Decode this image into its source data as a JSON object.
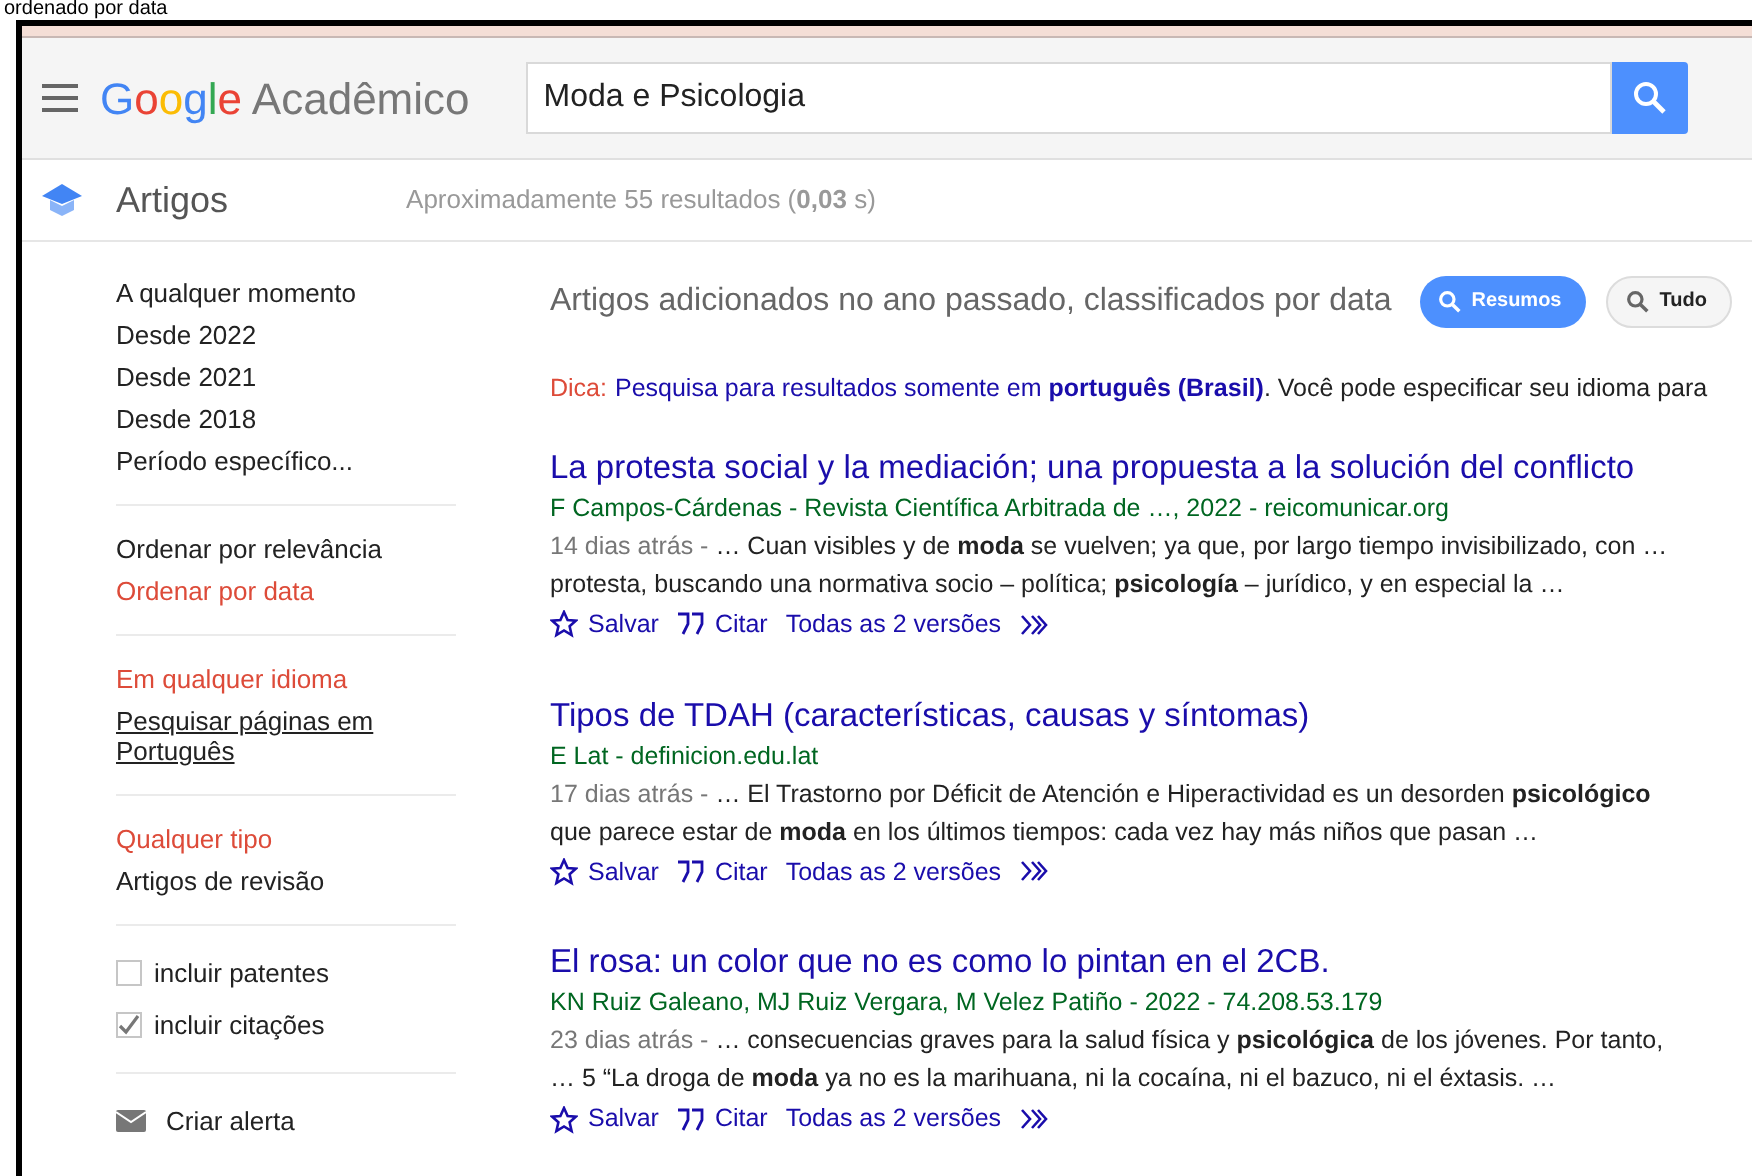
{
  "caption": "ordenado por data",
  "header": {
    "logo": {
      "brand": "Google",
      "product": "Acadêmico"
    },
    "search": {
      "value": "Moda e Psicologia"
    }
  },
  "section": {
    "title": "Artigos",
    "results_count": "Aproximadamente 55 resultados (**0,03** s)"
  },
  "sidebar": {
    "groups": [
      {
        "kind": "links",
        "items": [
          {
            "label": "A qualquer momento",
            "selected": false
          },
          {
            "label": "Desde 2022",
            "selected": false
          },
          {
            "label": "Desde 2021",
            "selected": false
          },
          {
            "label": "Desde 2018",
            "selected": false
          },
          {
            "label": "Período específico...",
            "selected": false
          }
        ]
      },
      {
        "kind": "links",
        "items": [
          {
            "label": "Ordenar por relevância",
            "selected": false
          },
          {
            "label": "Ordenar por data",
            "selected": true
          }
        ]
      },
      {
        "kind": "links",
        "items": [
          {
            "label": "Em qualquer idioma",
            "selected": true
          },
          {
            "label": "Pesquisar páginas em Português",
            "selected": false,
            "underlined": true
          }
        ]
      },
      {
        "kind": "links",
        "items": [
          {
            "label": "Qualquer tipo",
            "selected": true
          },
          {
            "label": "Artigos de revisão",
            "selected": false
          }
        ]
      },
      {
        "kind": "checkboxes",
        "items": [
          {
            "label": "incluir patentes",
            "checked": false
          },
          {
            "label": "incluir citações",
            "checked": true
          }
        ]
      },
      {
        "kind": "alert",
        "items": [
          {
            "label": "Criar alerta"
          }
        ]
      }
    ]
  },
  "heading": "Artigos adicionados no ano passado, classificados por data",
  "filters": [
    {
      "label": "Resumos",
      "selected": true
    },
    {
      "label": "Tudo",
      "selected": false
    }
  ],
  "tip": {
    "label": "Dica:",
    "link": "Pesquisa para resultados somente em **português (Brasil)**",
    "rest": ". Você pode especificar seu idioma para"
  },
  "results": [
    {
      "title": "La protesta social y la mediación; una propuesta a la solución del conflicto",
      "meta": "F Campos-Cárdenas - Revista Científica Arbitrada de …, 2022 - reicomunicar.org",
      "date": "14 dias atrás - ",
      "snippet": "… Cuan visibles y de **moda** se vuelven; ya que, por largo tiempo invisibilizado, con … protesta, buscando una normativa socio – política; **psicología** – jurídico, y en especial la …",
      "actions": [
        "Salvar",
        "Citar",
        "Todas as 2 versões"
      ]
    },
    {
      "title": "Tipos de TDAH (características, causas y síntomas)",
      "meta": "E Lat - definicion.edu.lat",
      "date": "17 dias atrás - ",
      "snippet": "… El Trastorno por Déficit de Atención e Hiperactividad es un desorden **psicológico** que parece estar de **moda** en los últimos tiempos: cada vez hay más niños que pasan …",
      "actions": [
        "Salvar",
        "Citar",
        "Todas as 2 versões"
      ]
    },
    {
      "title": "El rosa: un color que no es como lo pintan en el 2CB.",
      "meta": "KN Ruiz Galeano, MJ Ruiz Vergara, M Velez Patiño - 2022 - 74.208.53.179",
      "date": "23 dias atrás - ",
      "snippet": "… consecuencias graves para la salud física y **psicológica** de los jóvenes. Por tanto, … 5 “La droga de **moda** ya no es la marihuana, ni la cocaína, ni el bazuco, ni el éxtasis. …",
      "actions": [
        "Salvar",
        "Citar",
        "Todas as 2 versões"
      ]
    }
  ]
}
